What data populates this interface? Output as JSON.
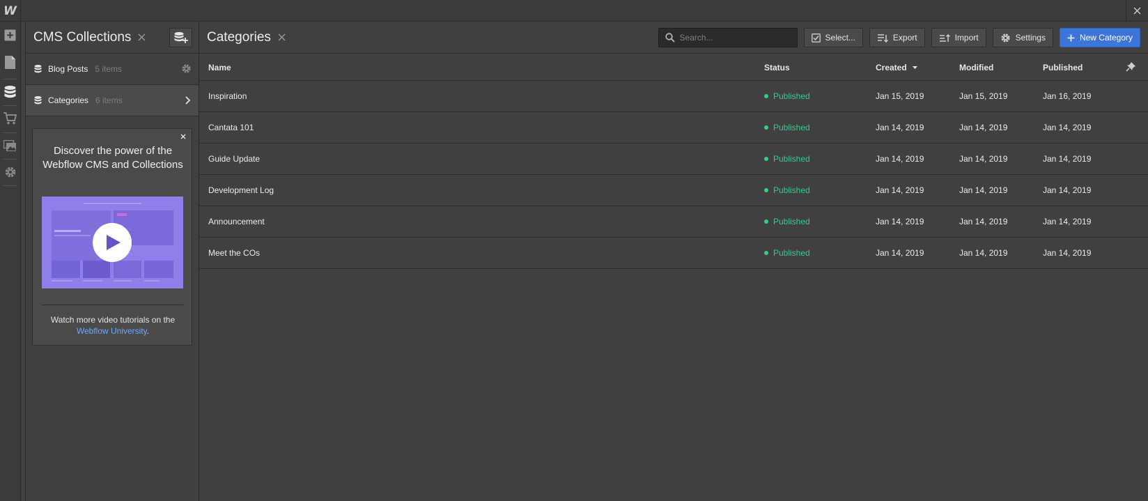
{
  "app": {
    "logo": "W"
  },
  "collections_panel": {
    "title": "CMS Collections",
    "items": [
      {
        "name": "Blog Posts",
        "count": "5 items"
      },
      {
        "name": "Categories",
        "count": "6 items"
      }
    ],
    "promo": {
      "title": "Discover the power of the Webflow CMS and Collections",
      "footer_text": "Watch more video tutorials on the",
      "link_text": "Webflow University",
      "footer_end": "."
    }
  },
  "main": {
    "title": "Categories",
    "search": {
      "placeholder": "Search..."
    },
    "toolbar": {
      "select_label": "Select...",
      "export_label": "Export",
      "import_label": "Import",
      "settings_label": "Settings",
      "new_label": "New Category"
    },
    "table": {
      "headers": {
        "name": "Name",
        "status": "Status",
        "created": "Created",
        "modified": "Modified",
        "published": "Published"
      },
      "rows": [
        {
          "name": "Inspiration",
          "status": "Published",
          "created": "Jan 15, 2019",
          "modified": "Jan 15, 2019",
          "published": "Jan 16, 2019"
        },
        {
          "name": "Cantata 101",
          "status": "Published",
          "created": "Jan 14, 2019",
          "modified": "Jan 14, 2019",
          "published": "Jan 14, 2019"
        },
        {
          "name": "Guide Update",
          "status": "Published",
          "created": "Jan 14, 2019",
          "modified": "Jan 14, 2019",
          "published": "Jan 14, 2019"
        },
        {
          "name": "Development Log",
          "status": "Published",
          "created": "Jan 14, 2019",
          "modified": "Jan 14, 2019",
          "published": "Jan 14, 2019"
        },
        {
          "name": "Announcement",
          "status": "Published",
          "created": "Jan 14, 2019",
          "modified": "Jan 14, 2019",
          "published": "Jan 14, 2019"
        },
        {
          "name": "Meet the COs",
          "status": "Published",
          "created": "Jan 14, 2019",
          "modified": "Jan 14, 2019",
          "published": "Jan 14, 2019"
        }
      ]
    }
  },
  "colors": {
    "background": "#404040",
    "accent_blue": "#3d74d8",
    "status_green": "#2fd08a",
    "link_blue": "#6fa8ff"
  }
}
